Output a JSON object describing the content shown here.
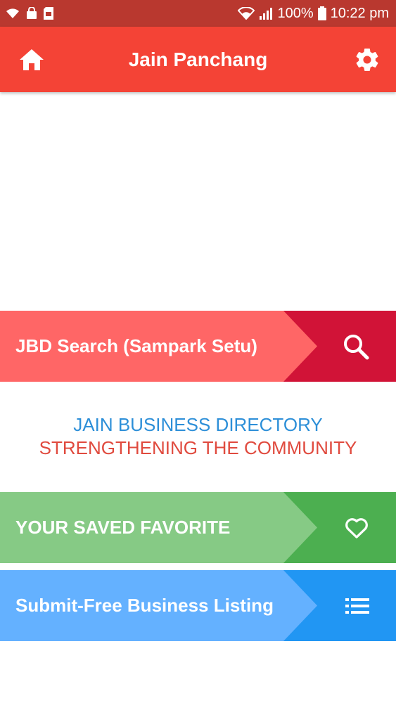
{
  "status_bar": {
    "battery": "100%",
    "time": "10:22 pm"
  },
  "app_bar": {
    "title": "Jain Panchang"
  },
  "search_banner": {
    "label": "JBD Search (Sampark Setu)",
    "colors": {
      "left": "#ff6666",
      "right": "#d11337"
    }
  },
  "tagline": {
    "line1": "JAIN BUSINESS DIRECTORY",
    "line2": "STRENGTHENING THE COMMUNITY",
    "colors": {
      "line1": "#2d8fd8",
      "line2": "#e04a3e"
    }
  },
  "favorites_banner": {
    "label": "YOUR SAVED FAVORITE",
    "colors": {
      "left": "#86ca85",
      "right": "#4caf50"
    }
  },
  "submit_banner": {
    "label": "Submit-Free Business Listing",
    "colors": {
      "left": "#64b1ff",
      "right": "#2196f3"
    }
  },
  "icons": {
    "home": "home-icon",
    "settings": "gear-icon",
    "search": "search-icon",
    "favorite": "heart-icon",
    "list": "list-icon"
  }
}
